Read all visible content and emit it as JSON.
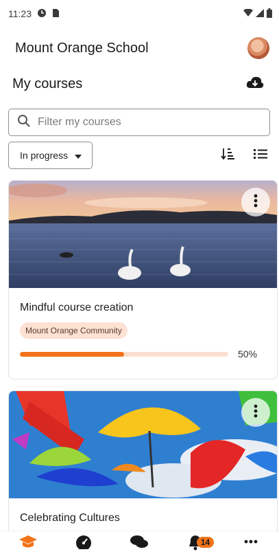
{
  "status_bar": {
    "time": "11:23",
    "left_icons": [
      "data-saver-icon",
      "sim-card-icon"
    ],
    "right_icons": [
      "wifi-icon",
      "signal-icon",
      "battery-icon"
    ]
  },
  "header": {
    "site_name": "Mount Orange School",
    "avatar_icon": "user-avatar"
  },
  "page": {
    "title": "My courses",
    "download_icon": "cloud-download-icon"
  },
  "search": {
    "placeholder": "Filter my courses",
    "value": ""
  },
  "filters": {
    "status_label": "In progress",
    "sort_icon": "sort-icon",
    "view_icon": "list-view-icon"
  },
  "courses": [
    {
      "name": "Mindful course creation",
      "category": "Mount Orange Community",
      "progress": 0.5,
      "progress_text": "50%",
      "image": "lake-swans"
    },
    {
      "name": "Celebrating Cultures",
      "image": "colorful-umbrellas"
    }
  ],
  "bottom_nav": {
    "items": [
      "my-courses-icon",
      "dashboard-icon",
      "messages-icon",
      "notifications-icon",
      "more-icon"
    ],
    "notification_count": "14"
  },
  "colors": {
    "accent": "#f27319",
    "badge_bg": "#fde1d3",
    "progress_track": "#fbe0cf"
  }
}
